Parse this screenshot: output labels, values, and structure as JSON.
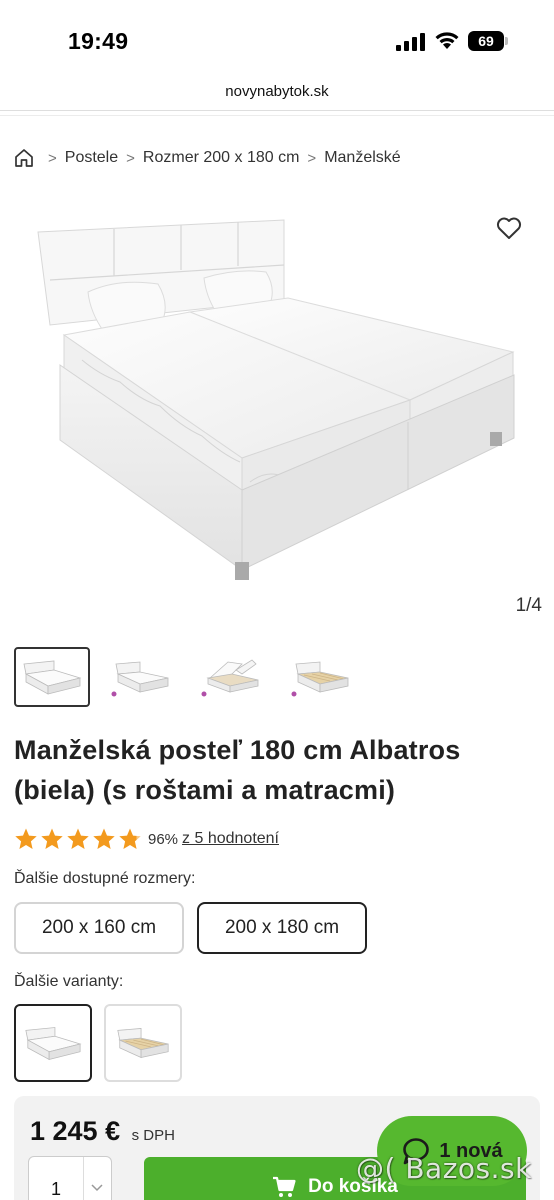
{
  "status_bar": {
    "time": "19:49",
    "battery": "69"
  },
  "browser": {
    "url": "novynabytok.sk"
  },
  "breadcrumb": {
    "items": [
      "Postele",
      "Rozmer 200 x 180 cm",
      "Manželské"
    ]
  },
  "gallery": {
    "counter": "1/4",
    "thumbnail_count": 4
  },
  "product": {
    "title": "Manželská posteľ 180 cm Albatros (biela) (s roštami a matracmi)",
    "rating_percent": "96%",
    "rating_link": "z 5 hodnotení",
    "stars": 4.8
  },
  "sizes": {
    "label": "Ďalšie dostupné rozmery:",
    "options": [
      "200 x 160 cm",
      "200 x 180 cm"
    ],
    "selected": "200 x 180 cm"
  },
  "variants": {
    "label": "Ďalšie varianty:"
  },
  "purchase": {
    "price": "1 245 €",
    "price_note": "s DPH",
    "quantity": "1",
    "cart_button": "Do košíka"
  },
  "chat": {
    "label": "1 nová"
  },
  "watermark": "@( Bazos.sk",
  "colors": {
    "accent_green": "#4caf2c",
    "star_orange": "#f39a1e"
  }
}
